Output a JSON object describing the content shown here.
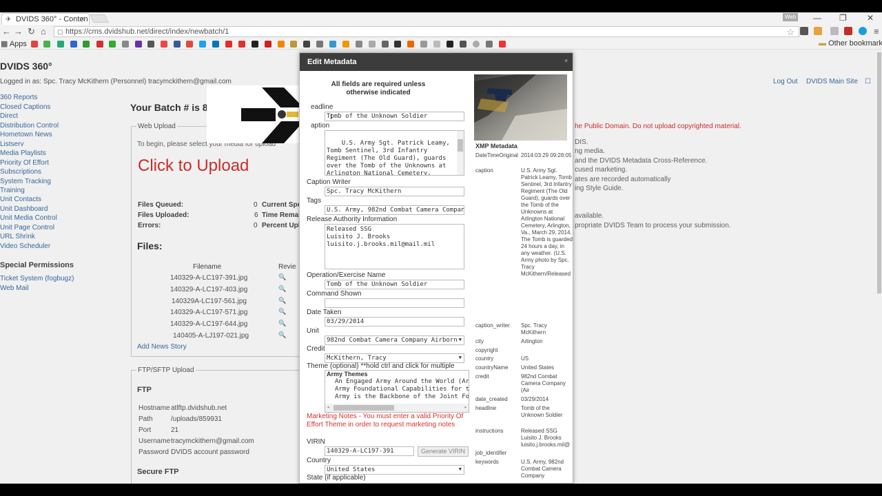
{
  "browser": {
    "tab_title": "DVIDS 360° - Conten",
    "tab_close": "×",
    "web_badge": "Web",
    "url": "https://cms.dvidshub.net/direct/index/newbatch/1",
    "apps_label": "Apps",
    "other_bookmarks": "Other bookmarks",
    "win_min": "—",
    "win_max": "❐",
    "win_close": "✕"
  },
  "site": {
    "title": "DVIDS 360°",
    "login_text": "Logged in as: Spc. Tracy McKithern (Personnel) tracymckithern@gmail.com",
    "logout": "Log Out",
    "main_site": "DVIDS Main Site"
  },
  "left_nav": [
    "360 Reports",
    "Closed Captions",
    "Direct",
    "Distribution Control",
    "Hometown News",
    "Listserv",
    "Media Playlists",
    "Priority Of Effort",
    "Subscriptions",
    "System Tracking",
    "Training",
    "Unit Contacts",
    "Unit Dashboard",
    "Unit Media Control",
    "Unit Page Control",
    "URL Shrink",
    "Video Scheduler"
  ],
  "special_permissions": {
    "heading": "Special Permissions",
    "items": [
      "Ticket System (fogbugz)",
      "Web Mail"
    ]
  },
  "batch": {
    "title": "Your Batch # is 8",
    "web_upload_legend": "Web Upload",
    "instructions": "To begin, please select your media for upload",
    "click_to_upload": "Click to Upload",
    "stats": [
      {
        "label": "Files Queued:",
        "value": "0",
        "right": "Current Spe"
      },
      {
        "label": "Files Uploaded:",
        "value": "6",
        "right": "Time Remai"
      },
      {
        "label": "Errors:",
        "value": "0",
        "right": "Percent Upl"
      }
    ],
    "files_heading": "Files:",
    "filename_header": "Filename",
    "review_header": "Revie",
    "files": [
      "140329-A-LC197-391.jpg",
      "140329-A-LC197-403.jpg",
      "140329A-LC197-561.jpg",
      "140329-A-LC197-571.jpg",
      "140329-A-LC197-644.jpg",
      "140405-A-LJ197-021.jpg"
    ],
    "add_news": "Add News Story",
    "ftp_legend": "FTP/SFTP Upload",
    "ftp_heading": "FTP",
    "ftp_rows": [
      {
        "k": "Hostname",
        "v": "atlftp.dvidshub.net"
      },
      {
        "k": "Path",
        "v": "/uploads/859931"
      },
      {
        "k": "Port",
        "v": "21"
      },
      {
        "k": "Username",
        "v": "tracymckithern@gmail.com"
      },
      {
        "k": "Password",
        "v": "DVIDS account password"
      }
    ],
    "sftp_heading": "Secure FTP"
  },
  "right_col": {
    "red": "he Public Domain.  Do not upload copyrighted material.",
    "lines": [
      "DIS.",
      "ng media.",
      "and the DVIDS Metadata Cross-Reference.",
      "cused marketing.",
      "ates are recorded automatically",
      "ing Style Guide.",
      "available.",
      "propriate DVIDS Team to process your submission."
    ]
  },
  "modal": {
    "title": "Edit Metadata",
    "close": "×",
    "required_note": "All fields are required unless otherwise indicated",
    "headline_label": "eadline",
    "headline_value": "Tomb of the Unknown Soldier",
    "caption_label": "aption",
    "caption_value": "U.S. Army Sgt. Patrick Leamy, Tomb Sentinel, 3rd Infantry Regiment (The Old Guard), guards over the Tomb of the Unknowns at Arlington National Cemetery, Arlington, Va., March 29, 2014. The Tomb is guarded 24 hours a",
    "caption_writer_label": "Caption Writer",
    "caption_writer_value": "Spc. Tracy McKithern",
    "tags_label": "Tags",
    "tags_value": "U.S. Army, 982nd Combat Camera Company",
    "release_label": "Release Authority Information",
    "release_value": "Released SSG\nLuisito J. Brooks\nluisito.j.brooks.mil@mail.mil",
    "operation_label": "Operation/Exercise Name",
    "operation_value": "Tomb of the Unknown Soldier",
    "command_label": "Command Shown",
    "command_value": "",
    "date_label": "Date Taken",
    "date_value": "03/29/2014",
    "unit_label": "Unit",
    "unit_value": "982nd Combat Camera Company Airborn",
    "credit_label": "Credit",
    "credit_value": "McKithern, Tracy",
    "theme_label": "Theme (optional) **hold ctrl and click for multiple",
    "theme_group": "Army Themes",
    "theme_options": [
      "An Engaged Army Around the World (Army",
      "Army Foundational Capabilities for the Join",
      "Army is the Backbone of the Joint Force (A"
    ],
    "marketing_warning": "Marketing Notes - You must enter a valid Priority Of Effort Theme in order to request marketing notes",
    "virin_label": "VIRIN",
    "virin_value": "140329-A-LC197-391",
    "generate_virin": "Generate VIRIN",
    "country_label": "Country",
    "country_value": "United States",
    "state_label": "State (if applicable)",
    "xmp": {
      "title": "XMP Metadata",
      "rows": [
        {
          "k": "DateTimeOriginal",
          "v": "2014:03:29 09:28:05"
        },
        {
          "k": "caption",
          "v": "U.S. Army Sgt. Patrick Leamy, Tomb Sentinel, 3rd Infantry Regiment (The Old Guard), guards over the Tomb of the Unknowns at Arlington National Cemetery, Arlington, Va., March 29, 2014. The Tomb is guarded 24 hours a day, in any weather. (U.S. Army photo by Spc. Tracy McKithern/Released"
        },
        {
          "k": "caption_writer",
          "v": "Spc. Tracy McKithern"
        },
        {
          "k": "city",
          "v": "Arlington"
        },
        {
          "k": "copyright",
          "v": ""
        },
        {
          "k": "country",
          "v": "US"
        },
        {
          "k": "countryName",
          "v": "United States"
        },
        {
          "k": "credit",
          "v": "982nd Combat Camera Company (Air"
        },
        {
          "k": "date_created",
          "v": "03/29/2014"
        },
        {
          "k": "headline",
          "v": "Tomb of the Unknown Soldier"
        },
        {
          "k": "instructions",
          "v": "Released SSG Luisito J. Brooks luisito.j.brooks.mil@"
        },
        {
          "k": "job_identifier",
          "v": ""
        },
        {
          "k": "keywords",
          "v": "U.S. Army, 982nd Combat Camera Company"
        }
      ]
    }
  },
  "colors": {
    "link": "#3a6ea5",
    "red": "#d9302c",
    "modal_header": "#3c3c3c"
  }
}
